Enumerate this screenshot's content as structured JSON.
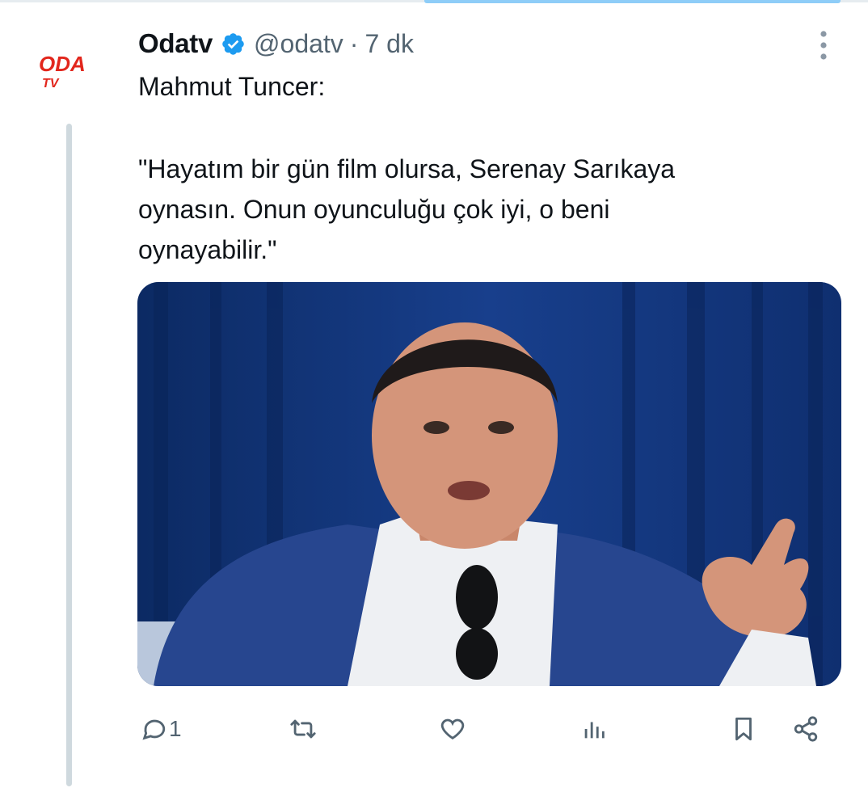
{
  "tweet": {
    "avatar": {
      "logo_text_top": "ODA",
      "logo_text_bottom": "TV",
      "brand_color": "#e2261c"
    },
    "display_name": "Odatv",
    "verified_color": "#1d9bf0",
    "handle": "@odatv",
    "separator": "·",
    "time": "7 dk",
    "text_line1": "Mahmut Tuncer:",
    "quote_lines": [
      "\"Hayatım bir gün film olursa, Serenay Sarıkaya",
      "oynasın. Onun oyunculuğu çok iyi, o beni",
      "oynayabilir.\""
    ],
    "actions": {
      "reply_count": "1",
      "icons": [
        "reply-icon",
        "retweet-icon",
        "like-icon",
        "views-icon",
        "bookmark-icon",
        "share-icon"
      ]
    }
  },
  "colors": {
    "text": "#0f1419",
    "secondary": "#536471",
    "thread_line": "#cfd9de",
    "accent_bar": "#8ecdf8"
  }
}
